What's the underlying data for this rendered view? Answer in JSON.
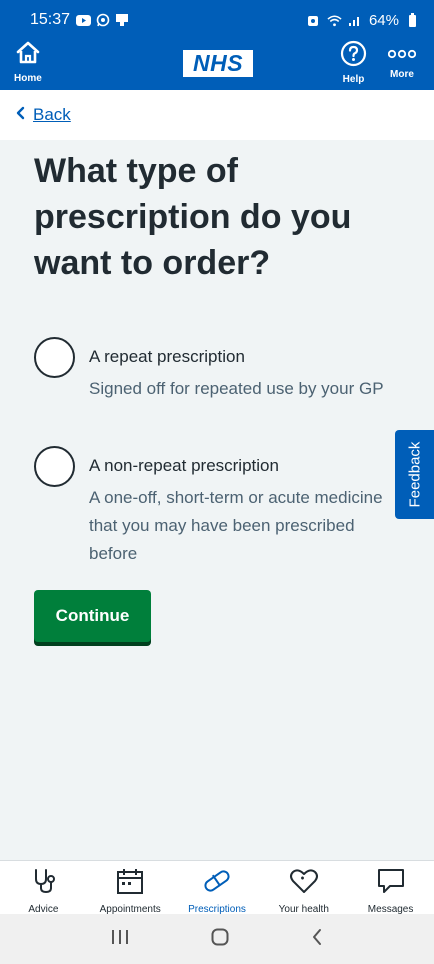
{
  "status_bar": {
    "time": "15:37",
    "battery": "64%",
    "left_icons": [
      "youtube-icon",
      "whatsapp-icon",
      "screenshot-icon"
    ],
    "right_icons": [
      "alarm-icon",
      "wifi-icon",
      "signal-icon",
      "battery-icon"
    ]
  },
  "header": {
    "home_label": "Home",
    "logo_text": "NHS",
    "help_label": "Help",
    "more_label": "More"
  },
  "back": {
    "label": "Back"
  },
  "page": {
    "title": "What type of prescription do you want to order?"
  },
  "options": [
    {
      "label": "A repeat prescription",
      "hint": "Signed off for repeated use by your GP",
      "selected": false
    },
    {
      "label": "A non-repeat prescription",
      "hint": "A one-off, short-term or acute medicine that you may have been prescribed before",
      "selected": false
    }
  ],
  "continue_label": "Continue",
  "feedback_label": "Feedback",
  "bottom_nav": [
    {
      "label": "Advice",
      "icon": "stethoscope-icon",
      "active": false
    },
    {
      "label": "Appointments",
      "icon": "calendar-icon",
      "active": false
    },
    {
      "label": "Prescriptions",
      "icon": "pill-icon",
      "active": true
    },
    {
      "label": "Your health",
      "icon": "heart-icon",
      "active": false
    },
    {
      "label": "Messages",
      "icon": "message-icon",
      "active": false
    }
  ],
  "colors": {
    "brand_blue": "#005eb8",
    "continue_green": "#007f3b",
    "background": "#f0f4f5",
    "text": "#212b32",
    "hint_text": "#4c6272"
  }
}
